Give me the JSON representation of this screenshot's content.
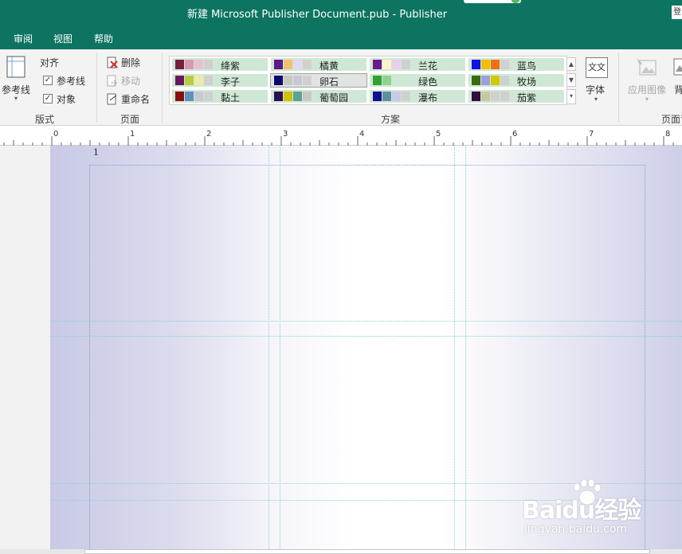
{
  "window": {
    "title": "新建 Microsoft Publisher Document.pub  -  Publisher",
    "account_label": "登"
  },
  "menu": {
    "tabs": [
      "审阅",
      "视图",
      "帮助"
    ]
  },
  "ribbon": {
    "layout_group": {
      "label": "版式",
      "guides_button": "参考线",
      "align_label": "对齐",
      "guides_checkbox": {
        "label": "参考线",
        "checked": true
      },
      "objects_checkbox": {
        "label": "对象",
        "checked": true
      }
    },
    "pages_group": {
      "label": "页面",
      "delete": "删除",
      "move": "移动",
      "rename": "重命名"
    },
    "scheme_group": {
      "label": "方案",
      "schemes": [
        {
          "name": "绛紫",
          "colors": [
            "#7a1f3d",
            "#d698b4",
            "#e8c0d2",
            "#d0d0d0"
          ]
        },
        {
          "name": "橘黄",
          "colors": [
            "#5c1a8a",
            "#f0c070",
            "#e0d8ec",
            "#d0d0d0"
          ]
        },
        {
          "name": "兰花",
          "colors": [
            "#6a1a8a",
            "#fbf5c8",
            "#e8d0ea",
            "#d0d0d0"
          ]
        },
        {
          "name": "蓝鸟",
          "colors": [
            "#1010e8",
            "#f0c000",
            "#f07010",
            "#d0d0d0"
          ]
        },
        {
          "name": "李子",
          "colors": [
            "#6a1a5a",
            "#b8cc40",
            "#f0e8a8",
            "#d0d0d0"
          ]
        },
        {
          "name": "卵石",
          "colors": [
            "#0a0a70",
            "#c8c8c0",
            "#c8c8d8",
            "#d0d0d0"
          ]
        },
        {
          "name": "绿色",
          "colors": [
            "#30a030",
            "#90d090",
            "#cfe8d5",
            "#cfe8d5"
          ]
        },
        {
          "name": "牧场",
          "colors": [
            "#3a6a10",
            "#a0a0d8",
            "#d0c800",
            "#d0d0d0"
          ]
        },
        {
          "name": "黏土",
          "colors": [
            "#8a1010",
            "#6090c0",
            "#c8c8d0",
            "#d0d0d0"
          ]
        },
        {
          "name": "葡萄园",
          "colors": [
            "#2a1050",
            "#d0c000",
            "#60a090",
            "#c8c8c8"
          ]
        },
        {
          "name": "瀑布",
          "colors": [
            "#101090",
            "#6090a0",
            "#c8c8e8",
            "#d0d0d0"
          ]
        },
        {
          "name": "茄紫",
          "colors": [
            "#301040",
            "#c8c8a0",
            "#d0d0d0",
            "#d0d0d0"
          ]
        }
      ],
      "selected": "卵石"
    },
    "font_button": {
      "icon_text": "文文",
      "label": "字体"
    },
    "apply_image_button": "应用图像",
    "background_button": "背",
    "page_bg_group_label": "页面背"
  },
  "ruler": {
    "labels": [
      "0",
      "1",
      "2",
      "3",
      "4",
      "5",
      "6",
      "7",
      "8"
    ]
  },
  "document": {
    "page_number": "1"
  },
  "watermark": {
    "main": "Baidu经验",
    "sub": "jingyan.baidu.com"
  }
}
